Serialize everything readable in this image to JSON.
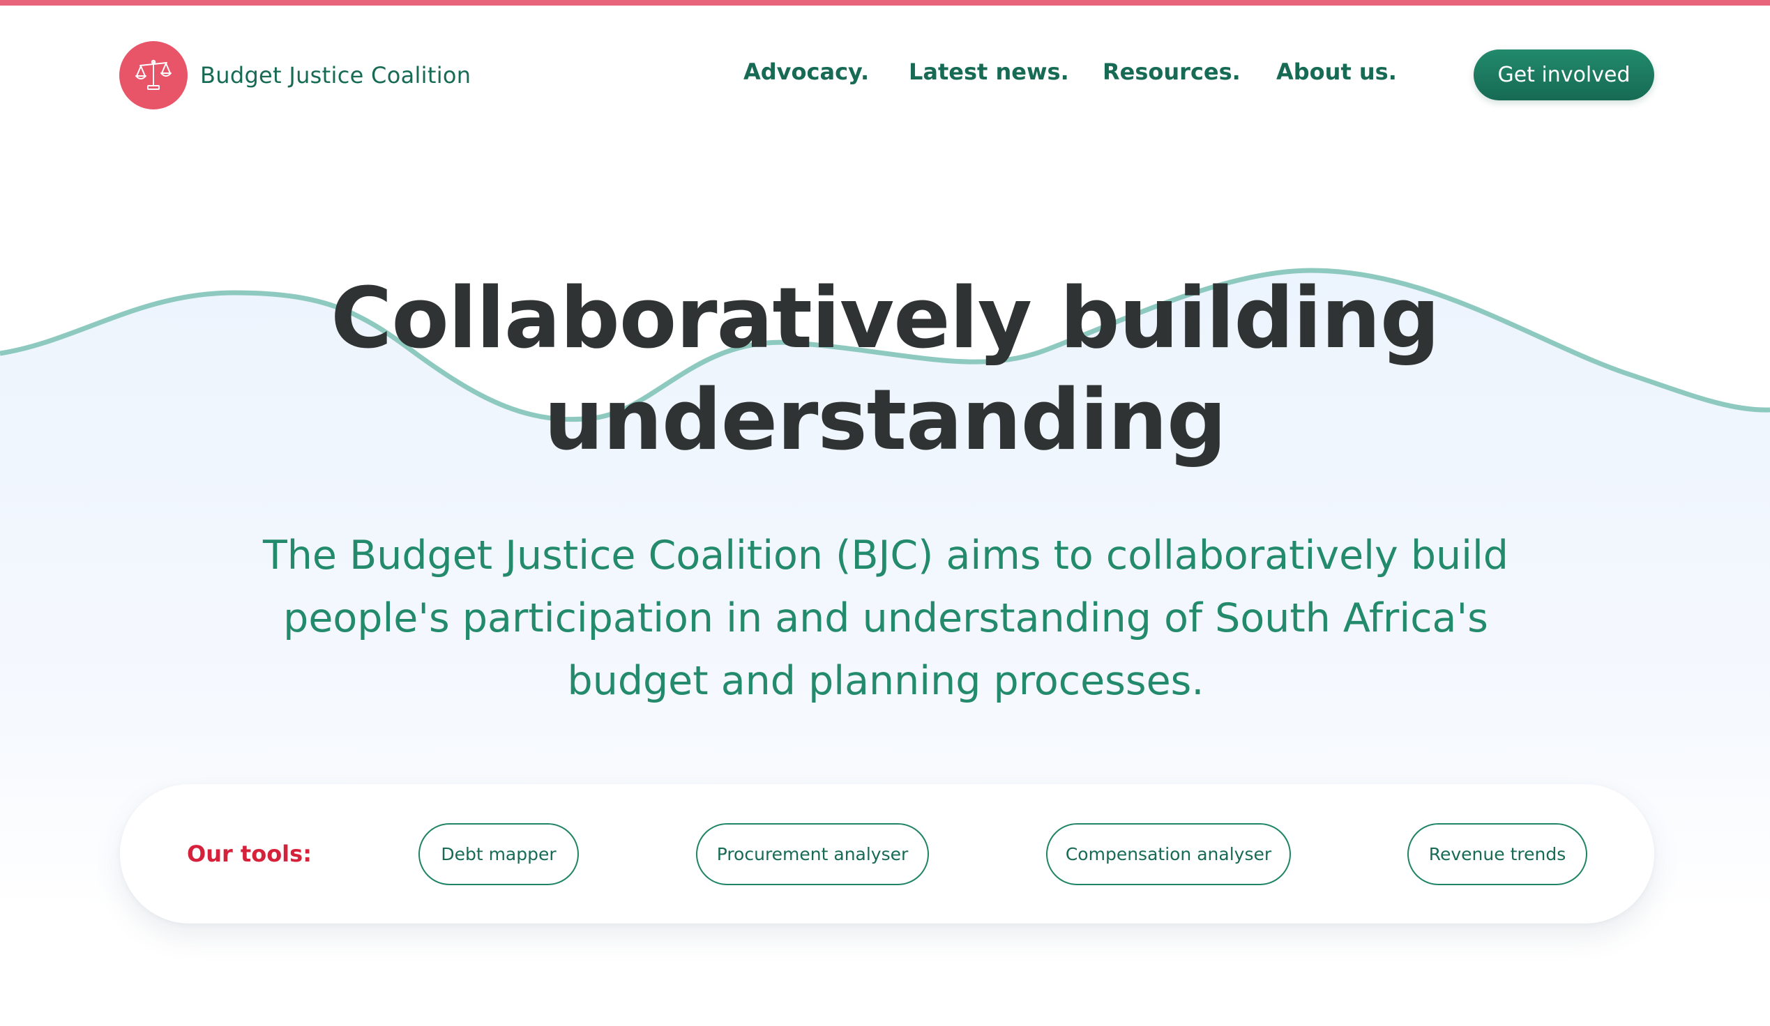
{
  "header": {
    "brand_name": "Budget Justice Coalition",
    "logo_icon": "scales-of-justice-icon",
    "nav": [
      {
        "label": "Advocacy."
      },
      {
        "label": "Latest news."
      },
      {
        "label": "Resources."
      },
      {
        "label": "About us."
      }
    ],
    "cta_label": "Get involved"
  },
  "hero": {
    "title_line1": "Collaboratively building",
    "title_line2": "understanding",
    "lead": "The Budget Justice Coalition (BJC) aims to collaboratively build people's participation in and understanding of South Africa's budget and planning processes."
  },
  "tools": {
    "label": "Our tools:",
    "items": [
      {
        "label": "Debt mapper"
      },
      {
        "label": "Procurement analyser"
      },
      {
        "label": "Compensation analyser"
      },
      {
        "label": "Revenue trends"
      }
    ]
  },
  "colors": {
    "accent_pink": "#e85468",
    "brand_green": "#176b55",
    "wave_teal": "#8ec9c0",
    "title_dark": "#2f3333",
    "tools_red": "#d6213b"
  }
}
